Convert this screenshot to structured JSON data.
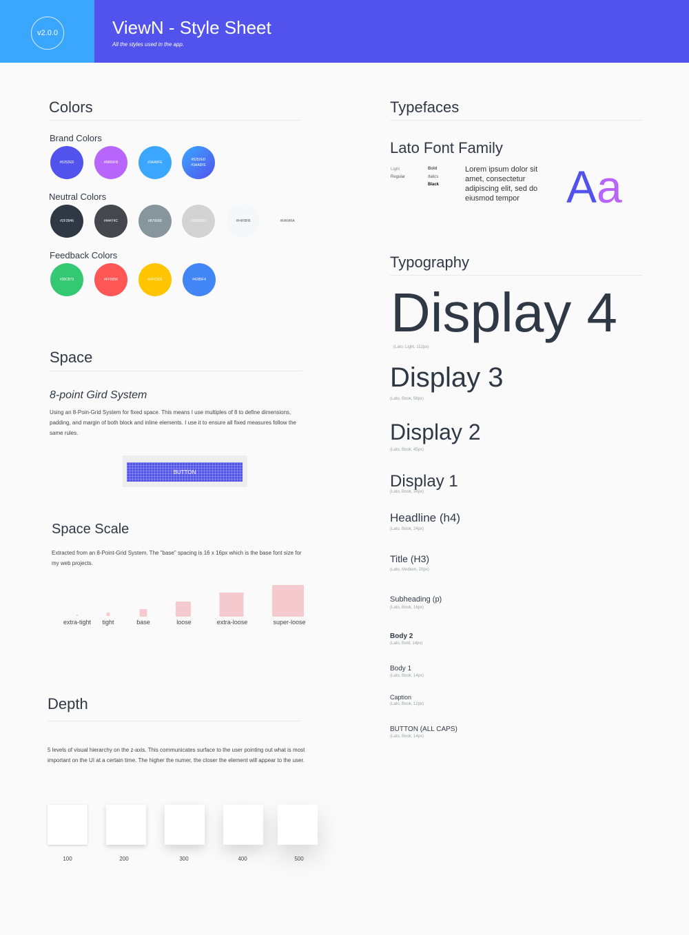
{
  "header": {
    "version": "v2.0.0",
    "title": "ViewN - Style Sheet",
    "subtitle": "All the styles used in the app."
  },
  "colors": {
    "title": "Colors",
    "brand": {
      "label": "Brand Colors",
      "swatches": [
        {
          "hex": "#5252ED",
          "text": "#5252ED"
        },
        {
          "hex": "#B865FB",
          "text": "#B865FB"
        },
        {
          "hex": "#3AA6FE",
          "text": "#3AA6FE"
        },
        {
          "hex": "#5252ED",
          "hex2": "#3AA6FE",
          "text": "#5252ED\n#3AA6FE"
        }
      ]
    },
    "neutral": {
      "label": "Neutral Colors",
      "swatches": [
        {
          "hex": "#2F3946",
          "text": "#2F3946"
        },
        {
          "hex": "#44474C",
          "text": "#44474C"
        },
        {
          "hex": "#87969D",
          "text": "#87969D"
        },
        {
          "hex": "#D3D3D3",
          "text": "#D3D3D3"
        },
        {
          "hex": "#F4F8FB",
          "text": "#F4F8FB"
        },
        {
          "hex": "#FAFAFA",
          "text": "#FAFAFA"
        }
      ]
    },
    "feedback": {
      "label": "Feedback Colors",
      "swatches": [
        {
          "hex": "#35C873",
          "text": "#35C873"
        },
        {
          "hex": "#FF5656",
          "text": "#FF5656"
        },
        {
          "hex": "#FFC501",
          "text": "#FFC501"
        },
        {
          "hex": "#4285F4",
          "text": "#4285F4"
        }
      ]
    }
  },
  "space": {
    "title": "Space",
    "grid_title": "8-point Gird System",
    "grid_text": "Using an 8-Poin-Grid System for fixed space. This means I use multiples of 8 to define dimensions, padding, and margin of both block and inline elements. I use it to ensure all fixed measures follow the same rules.",
    "button_label": "BUTTON",
    "scale_title": "Space Scale",
    "scale_text": "Extracted from an 8-Point-Grid System. The \"base\" spacing is 16 x 16px which is the base font size for my web projects.",
    "scale_items": [
      "extra-tight",
      "tight",
      "base",
      "loose",
      "extra-loose",
      "super-loose"
    ]
  },
  "depth": {
    "title": "Depth",
    "text": "5 levels of visual hierarchy on the z-axis. This communicates surface to the user pointing out what is most important on the UI at a certain time. The higher the numer, the closer the element will appear to the user.",
    "levels": [
      "100",
      "200",
      "300",
      "400",
      "500"
    ]
  },
  "typefaces": {
    "title": "Typefaces",
    "family": "Lato Font Family",
    "weights_left": [
      "Light",
      "Regular"
    ],
    "weights_right": [
      "Bold",
      "Italics",
      "Black"
    ],
    "sample": "Lorem ipsum dolor sit amet, consectetur adipiscing elit, sed do eiusmod tempor",
    "glyph_A": "A",
    "glyph_a": "a"
  },
  "typography": {
    "title": "Typography",
    "styles": [
      {
        "name": "Display 4",
        "spec": "(Lato, Light, 112px)"
      },
      {
        "name": "Display 3",
        "spec": "(Lato, Book, 56px)"
      },
      {
        "name": "Display 2",
        "spec": "(Lato, Book, 45px)"
      },
      {
        "name": "Display 1",
        "spec": "(Lato, Book, 34px)"
      },
      {
        "name": "Headline (h4)",
        "spec": "(Lato, Book, 24px)"
      },
      {
        "name": "Title (H3)",
        "spec": "(Lato, Medium, 20px)"
      },
      {
        "name": "Subheading (p)",
        "spec": "(Lato, Book, 16px)"
      },
      {
        "name": "Body 2",
        "spec": "(Lato, Bold, 14px)"
      },
      {
        "name": "Body 1",
        "spec": "(Lato, Book, 14px)"
      },
      {
        "name": "Caption",
        "spec": "(Lato, Book, 12px)"
      },
      {
        "name": "BUTTON (ALL CAPS)",
        "spec": "(Lato, Book, 14px)"
      }
    ]
  }
}
